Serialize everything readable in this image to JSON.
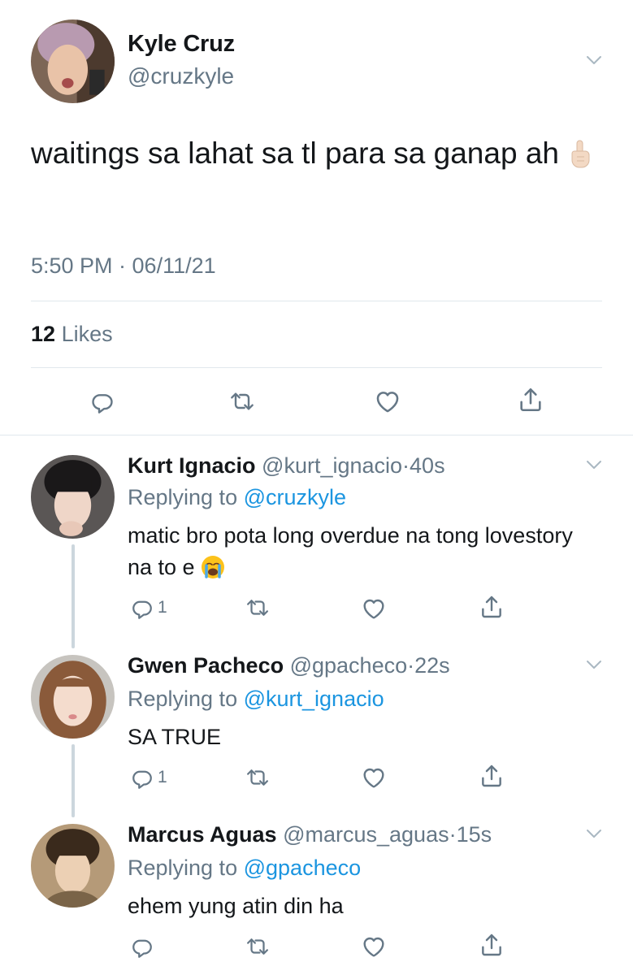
{
  "main_tweet": {
    "author": {
      "name": "Kyle Cruz",
      "handle": "@cruzkyle"
    },
    "text": "waitings sa lahat sa tl para sa ganap ah",
    "emoji": "index-pointing-up-emoji",
    "time": "5:50 PM · 06/11/21",
    "likes_count": "12",
    "likes_label": "Likes"
  },
  "replies": [
    {
      "name": "Kurt Ignacio",
      "handle": "@kurt_ignacio",
      "time": "40s",
      "replying_label": "Replying to",
      "replying_to": "@cruzkyle",
      "text": "matic bro pota long overdue na tong lovestory na to e",
      "emoji": "loudly-crying-face-emoji",
      "reply_count": "1"
    },
    {
      "name": "Gwen Pacheco",
      "handle": "@gpacheco",
      "time": "22s",
      "replying_label": "Replying to",
      "replying_to": "@kurt_ignacio",
      "text": "SA TRUE",
      "reply_count": "1"
    },
    {
      "name": "Marcus Aguas",
      "handle": "@marcus_aguas",
      "time": "15s",
      "replying_label": "Replying to",
      "replying_to": "@gpacheco",
      "text": "ehem yung atin din ha",
      "reply_count": ""
    }
  ],
  "colors": {
    "text": "#14171a",
    "secondary": "#657786",
    "link": "#1b95e0",
    "divider": "#e1e8ed",
    "thread_line": "#ccd6dd"
  },
  "icons": [
    "chevron-down-icon",
    "reply-icon",
    "retweet-icon",
    "like-icon",
    "share-icon"
  ]
}
